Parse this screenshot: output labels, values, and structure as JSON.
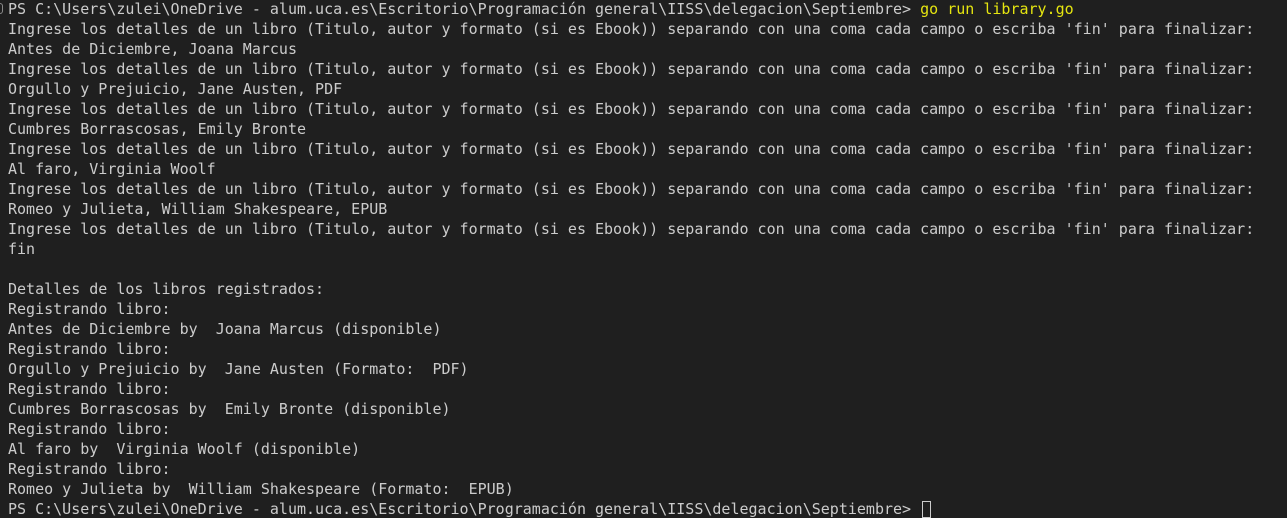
{
  "terminal": {
    "prompt": "PS C:\\Users\\zulei\\OneDrive - alum.uca.es\\Escritorio\\Programación general\\IISS\\delegacion\\Septiembre>",
    "command": "go run library.go",
    "output": [
      "Ingrese los detalles de un libro (Titulo, autor y formato (si es Ebook)) separando con una coma cada campo o escriba 'fin' para finalizar:",
      "Antes de Diciembre, Joana Marcus",
      "Ingrese los detalles de un libro (Titulo, autor y formato (si es Ebook)) separando con una coma cada campo o escriba 'fin' para finalizar:",
      "Orgullo y Prejuicio, Jane Austen, PDF",
      "Ingrese los detalles de un libro (Titulo, autor y formato (si es Ebook)) separando con una coma cada campo o escriba 'fin' para finalizar:",
      "Cumbres Borrascosas, Emily Bronte",
      "Ingrese los detalles de un libro (Titulo, autor y formato (si es Ebook)) separando con una coma cada campo o escriba 'fin' para finalizar:",
      "Al faro, Virginia Woolf",
      "Ingrese los detalles de un libro (Titulo, autor y formato (si es Ebook)) separando con una coma cada campo o escriba 'fin' para finalizar:",
      "Romeo y Julieta, William Shakespeare, EPUB",
      "Ingrese los detalles de un libro (Titulo, autor y formato (si es Ebook)) separando con una coma cada campo o escriba 'fin' para finalizar:",
      "fin",
      "",
      "Detalles de los libros registrados:",
      "Registrando libro:",
      "Antes de Diciembre by  Joana Marcus (disponible)",
      "Registrando libro:",
      "Orgullo y Prejuicio by  Jane Austen (Formato:  PDF)",
      "Registrando libro:",
      "Cumbres Borrascosas by  Emily Bronte (disponible)",
      "Registrando libro:",
      "Al faro by  Virginia Woolf (disponible)",
      "Registrando libro:",
      "Romeo y Julieta by  William Shakespeare (Formato:  EPUB)"
    ],
    "final_prompt": "PS C:\\Users\\zulei\\OneDrive - alum.uca.es\\Escritorio\\Programación general\\IISS\\delegacion\\Septiembre>",
    "colors": {
      "background": "#1f1f1f",
      "text": "#cccccc",
      "command": "#e5e510"
    }
  }
}
